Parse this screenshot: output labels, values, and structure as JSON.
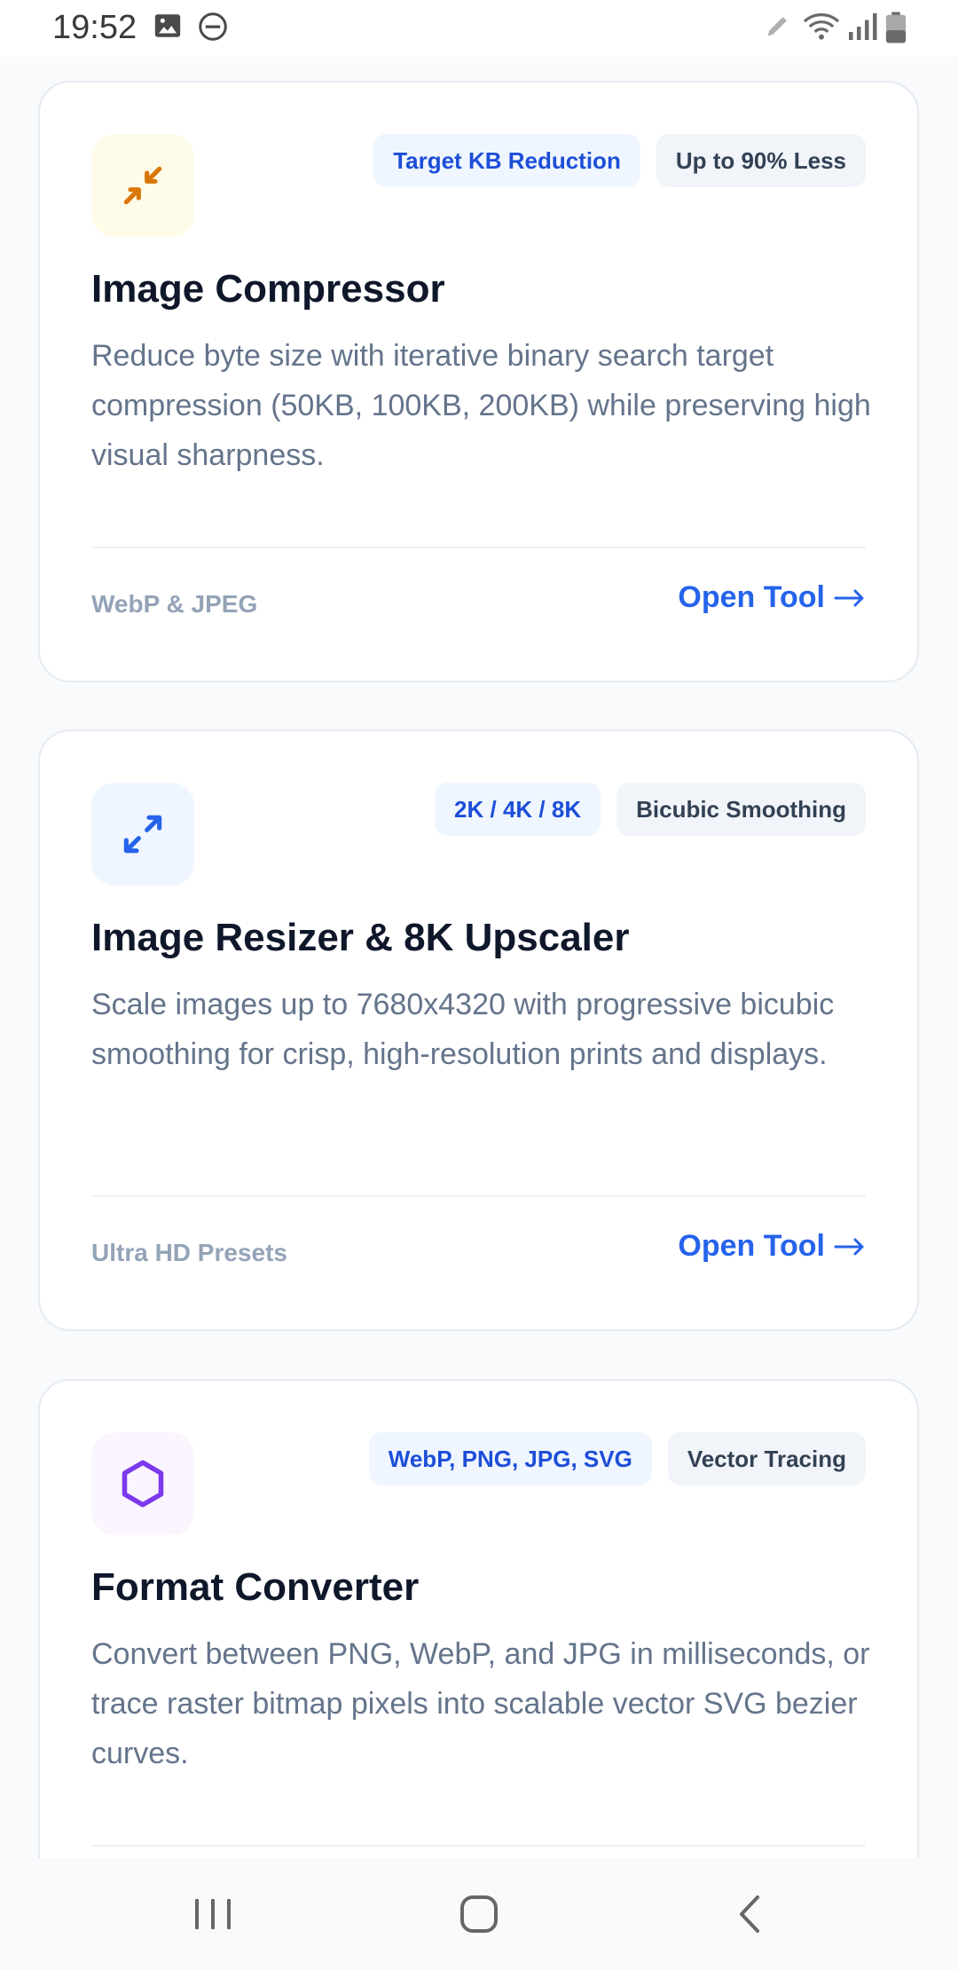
{
  "status_bar": {
    "time": "19:52",
    "left_icons": [
      "image-icon",
      "do-not-disturb-icon"
    ],
    "right_icons": [
      "pencil-icon",
      "wifi-icon",
      "signal-icon",
      "battery-icon"
    ]
  },
  "colors": {
    "accent": "#2563eb",
    "tag_blue_text": "#1d4ed8",
    "title": "#0f172a",
    "description": "#64748b",
    "footer_label": "#94a3b8"
  },
  "cards": [
    {
      "icon": "compress-arrows-icon",
      "icon_color": "#d97706",
      "icon_bg": "#fefbe8",
      "tags": [
        "Target KB Reduction",
        "Up to 90% Less"
      ],
      "title": "Image Compressor",
      "description": "Reduce byte size with iterative binary search target compression (50KB, 100KB, 200KB) while preserving high visual sharpness.",
      "footer_label": "WebP & JPEG",
      "link_label": "Open Tool"
    },
    {
      "icon": "expand-arrows-icon",
      "icon_color": "#2563eb",
      "icon_bg": "#eff6ff",
      "tags": [
        "2K / 4K / 8K",
        "Bicubic Smoothing"
      ],
      "title": "Image Resizer & 8K Upscaler",
      "description": "Scale images up to 7680x4320 with progressive bicubic smoothing for crisp, high-resolution prints and displays.",
      "footer_label": "Ultra HD Presets",
      "link_label": "Open Tool"
    },
    {
      "icon": "hexagon-icon",
      "icon_color": "#7c3aed",
      "icon_bg": "#faf5ff",
      "tags": [
        "WebP, PNG, JPG, SVG",
        "Vector Tracing"
      ],
      "title": "Format Converter",
      "description": "Convert between PNG, WebP, and JPG in milliseconds, or trace raster bitmap pixels into scalable vector SVG bezier curves.",
      "footer_label": "",
      "link_label": ""
    }
  ],
  "nav_bar": {
    "buttons": [
      "recent-apps-icon",
      "home-icon",
      "back-icon"
    ]
  }
}
